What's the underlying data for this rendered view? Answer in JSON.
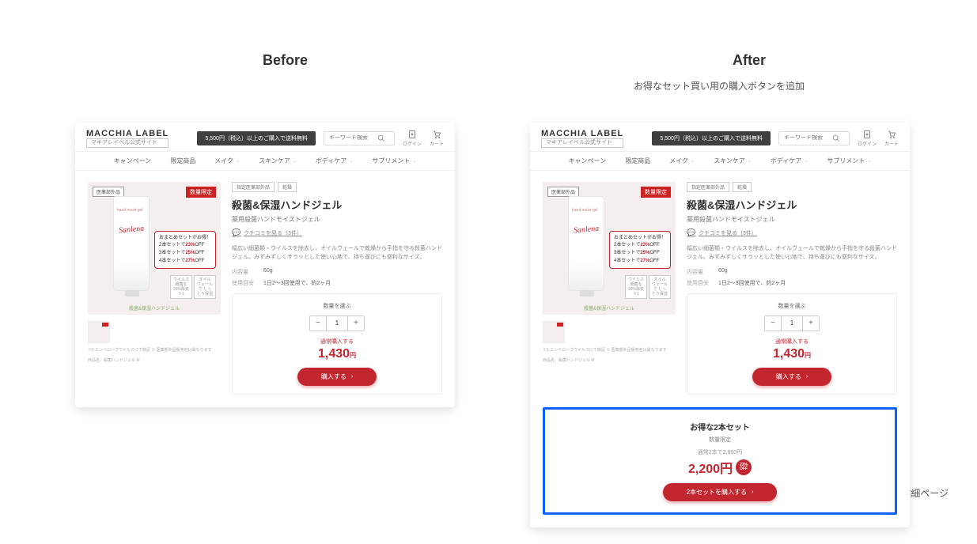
{
  "labels": {
    "before": "Before",
    "after": "After",
    "subheading": "お得なセット買い用の購入ボタンを追加",
    "footer": "商品詳細ページ"
  },
  "header": {
    "brand": "MACCHIA LABEL",
    "brand_sub": "マキアレイベル公式サイト",
    "banner": "5,500円（税込）以上のご購入で送料無料",
    "search_placeholder": "キーワード検索",
    "login": "ログイン",
    "cart": "カート"
  },
  "nav": [
    "キャンペーン",
    "限定商品",
    "メイク",
    "スキンケア",
    "ボディケア",
    "サプリメント"
  ],
  "product": {
    "med_badge": "医薬部外品",
    "limited_badge": "数量限定",
    "tube_label": "hand moist gel",
    "tube_script": "Sanlena",
    "promo_title": "おまとめセットがお得！",
    "promo_lines": [
      {
        "pre": "2本セットで",
        "pct": "23%",
        "suf": "OFF"
      },
      {
        "pre": "3本セットで",
        "pct": "25%",
        "suf": "OFF"
      },
      {
        "pre": "4本セットで",
        "pct": "27%",
        "suf": "OFF"
      }
    ],
    "caption": "殺菌&保湿ハンドジェル",
    "feat1": "ウイルス\n細菌を\n99%除去※1",
    "feat2": "オイル\nヴェールで\nしっとり保湿",
    "ingredients": "※1 エンベロープウイルスにて検証\n※ 医薬部外品販売名は異なります",
    "ingredients2": "商品名：殺菌ハンドジェル M",
    "tags": [
      "指定医薬部外品",
      "乾燥"
    ],
    "title": "殺菌&保湿ハンドジェル",
    "subtitle": "薬用殺菌ハンドモイストジェル",
    "review": "クチコミを見る（3件）",
    "desc": "幅広い細菌類・ウイルスを除去し、オイルヴェールで乾燥から手指を守る殺菌ハンドジェル。みずみずしくサラッとした使い心地で、持ち運びにも便利なサイズ。",
    "specs": [
      {
        "k": "内容量",
        "v": "60g"
      },
      {
        "k": "使用目安",
        "v": "1日2〜3回使用で、約2ヶ月"
      }
    ]
  },
  "buy": {
    "qty_label": "数量を選ぶ",
    "qty": "1",
    "price_label": "通常購入する",
    "price": "1,430",
    "yen": "円",
    "button": "購入する"
  },
  "set": {
    "title": "お得な2本セット",
    "limited": "数量限定",
    "strike": "通常2本で2,860円",
    "price": "2,200円",
    "off_pct": "23%",
    "off_txt": "OFF",
    "button": "2本セットを購入する"
  }
}
